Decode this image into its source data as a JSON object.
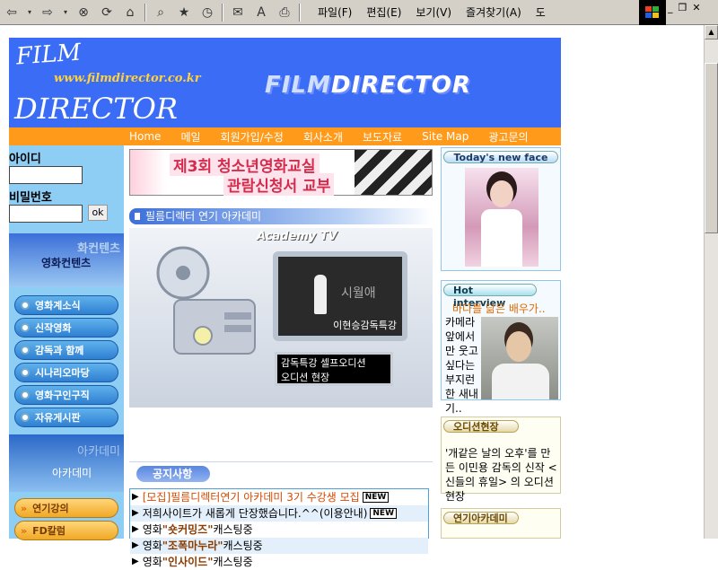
{
  "browser": {
    "menu": [
      "파일(F)",
      "편집(E)",
      "보기(V)",
      "즐겨찾기(A)",
      "도"
    ]
  },
  "header": {
    "logo_film": "FILM",
    "logo_url": "www.filmdirector.co.kr",
    "logo_director": "DIRECTOR",
    "big_title_a": "FILM",
    "big_title_b": "DIRECTOR",
    "nav": [
      "Home",
      "메일",
      "회원가입/수정",
      "회사소개",
      "보도자료",
      "Site Map",
      "광고문의"
    ]
  },
  "login": {
    "id_label": "아이디",
    "pw_label": "비밀번호",
    "ok_label": "ok"
  },
  "left": {
    "content_banner": "영화컨텐츠",
    "content_banner_ghost": "화컨텐츠",
    "menu": [
      "영화계소식",
      "신작영화",
      "감독과 함께",
      "시나리오마당",
      "영화구인구직",
      "자유게시판"
    ],
    "academy_banner": "아카데미",
    "academy_banner_ghost": "아카데미",
    "academy_menu": [
      "연기강의",
      "FD칼럼"
    ]
  },
  "mid": {
    "banner_line1": "제3회 청소년영화교실",
    "banner_line2": "관람신청서 교부",
    "section_title": "필름디렉터 연기 아카데미",
    "tv_title": "Academy TV",
    "tv_caption": "이현승감독특강",
    "tv_screen_text": "시월애",
    "tv_box_line1": "감독특강 셀프오디션",
    "tv_box_line2": "오디션 현장",
    "notice_title": "공지사항",
    "notices": [
      {
        "text": "[모집]필름디렉터연기 아카데미 3기 수강생 모집",
        "new": "NEW"
      },
      {
        "text": "저희사이트가 새롭게 단장했습니다.^^(이용안내)",
        "new": "NEW"
      },
      {
        "pre": "영화 ",
        "bold": "\"숏커밍즈\"",
        "post": " 캐스팅중"
      },
      {
        "pre": "영화 ",
        "bold": "\"조폭마누라\"",
        "post": "캐스팅중"
      },
      {
        "pre": "영화 ",
        "bold": "\"인사이드\"",
        "post": " 캐스팅중"
      }
    ]
  },
  "right": {
    "today_label": "Today's new face",
    "hot_label": "Hot interview",
    "hot_sub": "바다를 닮은 배우가..",
    "hot_text": "카메라 앞에서 만 웃고 싶다는 부지런 한 새내기..",
    "audition_label": "오디션현장",
    "audition_text": "'개같은 날의 오후'를 만든 이민용 감독의 신작 <신들의 휴일> 의 오디션 현장",
    "acad_label": "연기아카데미"
  }
}
